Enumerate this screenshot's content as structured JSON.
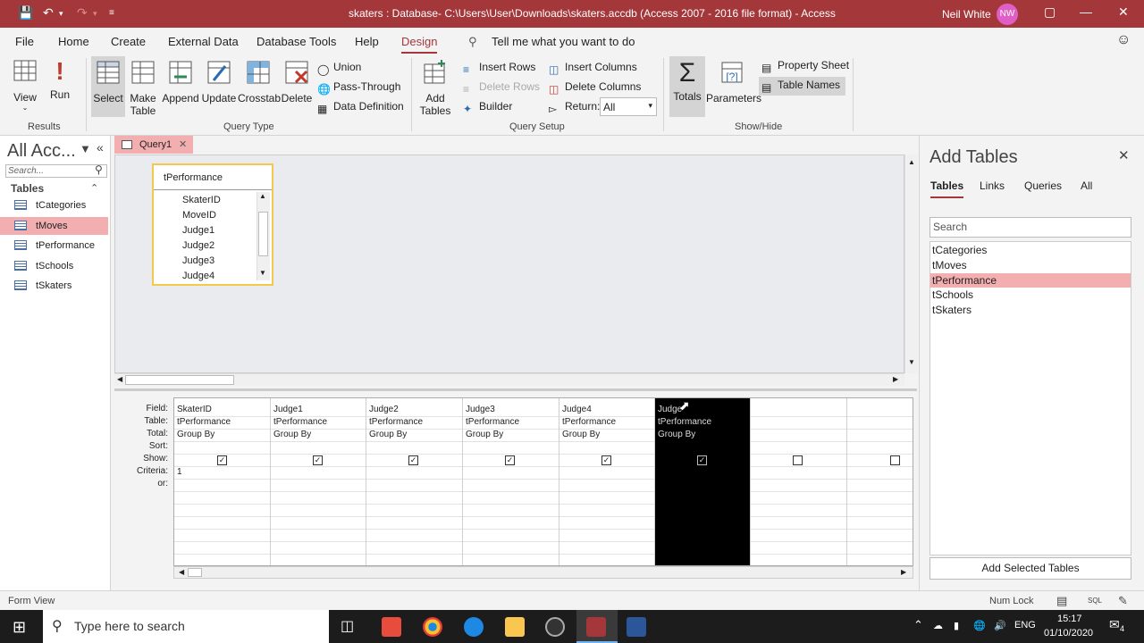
{
  "titlebar": {
    "title": "skaters : Database- C:\\Users\\User\\Downloads\\skaters.accdb (Access 2007 - 2016 file format)  -  Access",
    "user": "Neil White",
    "initials": "NW"
  },
  "menu": {
    "tabs": [
      "File",
      "Home",
      "Create",
      "External Data",
      "Database Tools",
      "Help",
      "Design"
    ],
    "tell_me": "Tell me what you want to do"
  },
  "ribbon": {
    "results": {
      "view": "View",
      "run": "Run",
      "label": "Results"
    },
    "query_type": {
      "select": "Select",
      "make_table_1": "Make",
      "make_table_2": "Table",
      "append": "Append",
      "update": "Update",
      "crosstab": "Crosstab",
      "delete": "Delete",
      "union": "Union",
      "pass_through": "Pass-Through",
      "data_definition": "Data Definition",
      "label": "Query Type"
    },
    "query_setup": {
      "add_tables_1": "Add",
      "add_tables_2": "Tables",
      "insert_rows": "Insert Rows",
      "delete_rows": "Delete Rows",
      "builder": "Builder",
      "insert_columns": "Insert Columns",
      "delete_columns": "Delete Columns",
      "return_label": "Return:",
      "return_value": "All",
      "label": "Query Setup"
    },
    "show_hide": {
      "totals": "Totals",
      "parameters": "Parameters",
      "property_sheet": "Property Sheet",
      "table_names": "Table Names",
      "label": "Show/Hide"
    }
  },
  "nav": {
    "title": "All Acc...",
    "search_placeholder": "Search...",
    "section": "Tables",
    "items": [
      "tCategories",
      "tMoves",
      "tPerformance",
      "tSchools",
      "tSkaters"
    ],
    "selected": "tMoves"
  },
  "document": {
    "tab": "Query1",
    "table_box": {
      "name": "tPerformance",
      "fields": [
        "SkaterID",
        "MoveID",
        "Judge1",
        "Judge2",
        "Judge3",
        "Judge4"
      ]
    },
    "grid": {
      "row_labels": [
        "Field:",
        "Table:",
        "Total:",
        "Sort:",
        "Show:",
        "Criteria:",
        "or:"
      ],
      "columns": [
        {
          "field": "SkaterID",
          "table": "tPerformance",
          "total": "Group By",
          "show": true,
          "criteria": "1"
        },
        {
          "field": "Judge1",
          "table": "tPerformance",
          "total": "Group By",
          "show": true,
          "criteria": ""
        },
        {
          "field": "Judge2",
          "table": "tPerformance",
          "total": "Group By",
          "show": true,
          "criteria": ""
        },
        {
          "field": "Judge3",
          "table": "tPerformance",
          "total": "Group By",
          "show": true,
          "criteria": ""
        },
        {
          "field": "Judge4",
          "table": "tPerformance",
          "total": "Group By",
          "show": true,
          "criteria": ""
        },
        {
          "field": "Judge",
          "table": "tPerformance",
          "total": "Group By",
          "show": true,
          "criteria": ""
        },
        {
          "field": "",
          "table": "",
          "total": "",
          "show": false,
          "criteria": ""
        },
        {
          "field": "",
          "table": "",
          "total": "",
          "show": false,
          "criteria": ""
        }
      ],
      "selected_column": 5
    }
  },
  "add_tables": {
    "title": "Add Tables",
    "tabs": [
      "Tables",
      "Links",
      "Queries",
      "All"
    ],
    "search_placeholder": "Search",
    "items": [
      "tCategories",
      "tMoves",
      "tPerformance",
      "tSchools",
      "tSkaters"
    ],
    "selected": "tPerformance",
    "button": "Add Selected Tables"
  },
  "status": {
    "left": "Form View",
    "num_lock": "Num Lock",
    "sql": "SQL"
  },
  "taskbar": {
    "search": "Type here to search",
    "lang": "ENG",
    "time": "15:17",
    "date": "01/10/2020",
    "notifications": "4"
  },
  "colors": {
    "accent": "#a4373a",
    "selected": "#f3aeb0",
    "taskbar": "#1c1c1c"
  }
}
